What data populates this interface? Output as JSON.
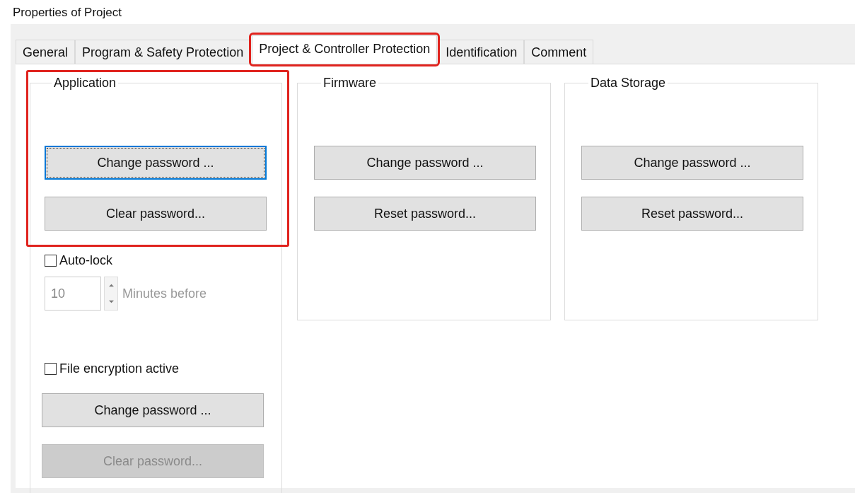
{
  "window": {
    "title": "Properties of Project"
  },
  "tabs": [
    {
      "label": "General",
      "selected": false,
      "highlighted": false
    },
    {
      "label": "Program & Safety Protection",
      "selected": false,
      "highlighted": false
    },
    {
      "label": "Project & Controller Protection",
      "selected": true,
      "highlighted": true
    },
    {
      "label": "Identification",
      "selected": false,
      "highlighted": false
    },
    {
      "label": "Comment",
      "selected": false,
      "highlighted": false
    }
  ],
  "groups": [
    {
      "title": "Application",
      "highlighted": true,
      "controls": [
        {
          "kind": "button",
          "label": "Change password ...",
          "focused": true,
          "disabled": false
        },
        {
          "kind": "button",
          "label": "Clear password...",
          "focused": false,
          "disabled": false
        },
        {
          "kind": "checkbox",
          "label": "Auto-lock",
          "checked": false
        },
        {
          "kind": "spinner",
          "value": "10",
          "unit": "Minutes before",
          "disabled": true
        },
        {
          "kind": "checkbox",
          "label": "File encryption active",
          "checked": false
        },
        {
          "kind": "button",
          "label": "Change password ...",
          "focused": false,
          "disabled": false
        },
        {
          "kind": "button",
          "label": "Clear password...",
          "focused": false,
          "disabled": true
        }
      ]
    },
    {
      "title": "Firmware",
      "highlighted": false,
      "controls": [
        {
          "kind": "button",
          "label": "Change password ...",
          "focused": false,
          "disabled": false
        },
        {
          "kind": "button",
          "label": "Reset password...",
          "focused": false,
          "disabled": false
        }
      ]
    },
    {
      "title": "Data Storage",
      "highlighted": false,
      "controls": [
        {
          "kind": "button",
          "label": "Change password ...",
          "focused": false,
          "disabled": false
        },
        {
          "kind": "button",
          "label": "Reset password...",
          "focused": false,
          "disabled": false
        }
      ]
    }
  ]
}
